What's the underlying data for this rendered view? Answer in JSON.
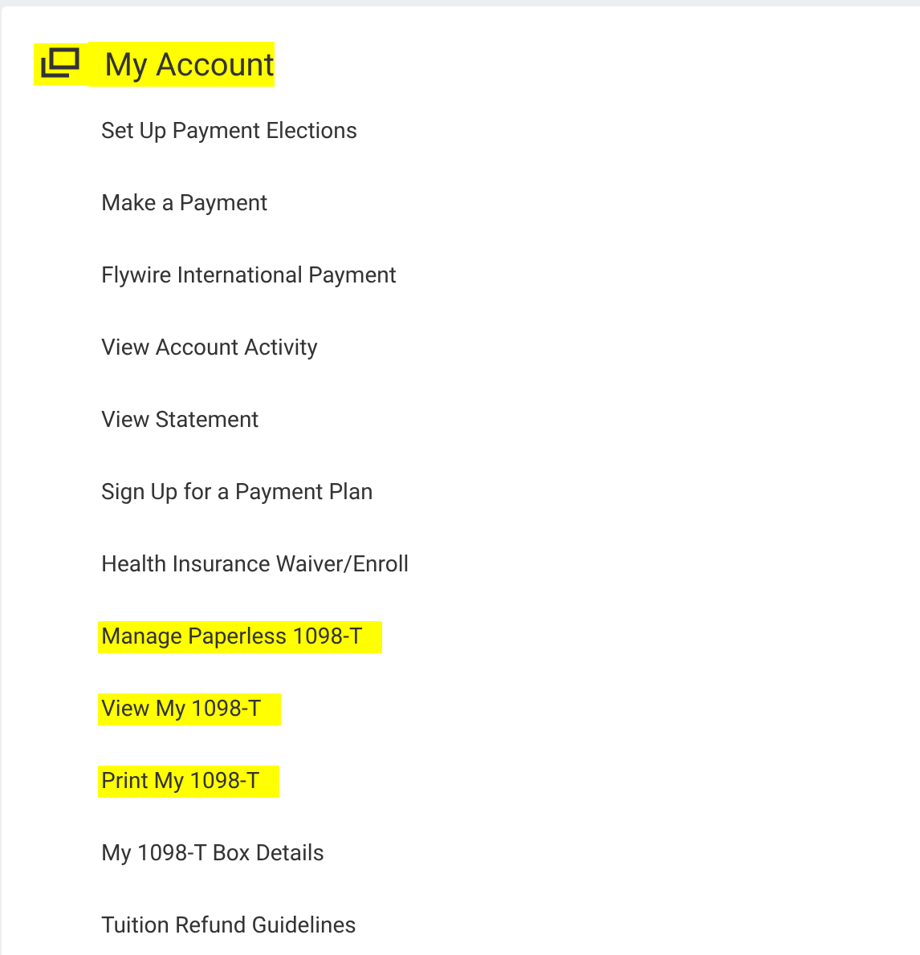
{
  "title": {
    "text": "My Account",
    "highlighted": true
  },
  "items": [
    {
      "label": "Set Up Payment Elections",
      "highlighted": false
    },
    {
      "label": "Make a Payment",
      "highlighted": false
    },
    {
      "label": "Flywire International Payment",
      "highlighted": false
    },
    {
      "label": "View Account Activity",
      "highlighted": false
    },
    {
      "label": "View Statement",
      "highlighted": false
    },
    {
      "label": "Sign Up for a Payment Plan",
      "highlighted": false
    },
    {
      "label": "Health Insurance Waiver/Enroll",
      "highlighted": false
    },
    {
      "label": "Manage Paperless 1098-T",
      "highlighted": true
    },
    {
      "label": "View My 1098-T",
      "highlighted": true
    },
    {
      "label": "Print My 1098-T",
      "highlighted": true
    },
    {
      "label": "My 1098-T Box Details",
      "highlighted": false
    },
    {
      "label": "Tuition Refund Guidelines",
      "highlighted": false
    }
  ]
}
